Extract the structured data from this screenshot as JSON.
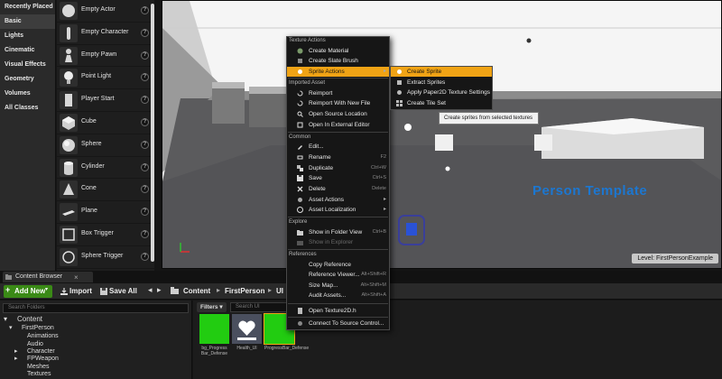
{
  "place_actors": {
    "categories": [
      "Recently Placed",
      "Basic",
      "Lights",
      "Cinematic",
      "Visual Effects",
      "Geometry",
      "Volumes",
      "All Classes"
    ],
    "selected_category": "Basic",
    "items": [
      {
        "name": "Empty Actor",
        "icon": "empty-actor-icon"
      },
      {
        "name": "Empty Character",
        "icon": "empty-character-icon"
      },
      {
        "name": "Empty Pawn",
        "icon": "empty-pawn-icon"
      },
      {
        "name": "Point Light",
        "icon": "point-light-icon"
      },
      {
        "name": "Player Start",
        "icon": "player-start-icon"
      },
      {
        "name": "Cube",
        "icon": "cube-icon"
      },
      {
        "name": "Sphere",
        "icon": "sphere-icon"
      },
      {
        "name": "Cylinder",
        "icon": "cylinder-icon"
      },
      {
        "name": "Cone",
        "icon": "cone-icon"
      },
      {
        "name": "Plane",
        "icon": "plane-icon"
      },
      {
        "name": "Box Trigger",
        "icon": "box-trigger-icon"
      },
      {
        "name": "Sphere Trigger",
        "icon": "sphere-trigger-icon"
      }
    ],
    "info_glyph": "?"
  },
  "viewport": {
    "floor_text": "Person Template",
    "level_label": "Level:  FirstPersonExample"
  },
  "context_menu": {
    "sections": {
      "texture_actions": "Texture Actions",
      "imported_asset": "Imported Asset",
      "common": "Common",
      "explore": "Explore",
      "references": "References"
    },
    "items": {
      "create_material": "Create Material",
      "create_slate_brush": "Create Slate Brush",
      "sprite_actions": "Sprite Actions",
      "reimport": "Reimport",
      "reimport_new_file": "Reimport With New File",
      "open_source_location": "Open Source Location",
      "open_external_editor": "Open In External Editor",
      "edit": "Edit...",
      "rename": "Rename",
      "duplicate": "Duplicate",
      "save": "Save",
      "delete": "Delete",
      "asset_actions": "Asset Actions",
      "asset_localization": "Asset Localization",
      "show_in_folder_view": "Show in Folder View",
      "show_in_explorer": "Show in Explorer",
      "copy_reference": "Copy Reference",
      "reference_viewer": "Reference Viewer...",
      "size_map": "Size Map...",
      "audit_assets": "Audit Assets...",
      "open_texture2d_h": "Open Texture2D.h",
      "connect_source_control": "Connect To Source Control..."
    },
    "shortcuts": {
      "rename": "F2",
      "duplicate": "Ctrl+W",
      "save": "Ctrl+S",
      "delete": "Delete",
      "show_in_folder_view": "Ctrl+B",
      "reference_viewer": "Alt+Shift+R",
      "size_map": "Alt+Shift+M",
      "audit_assets": "Alt+Shift+A"
    },
    "highlight_color": "#f0a315"
  },
  "submenu": {
    "items": {
      "create_sprite": "Create Sprite",
      "extract_sprites": "Extract Sprites",
      "apply_paper2d": "Apply Paper2D Texture Settings",
      "create_tile_set": "Create Tile Set"
    },
    "tooltip": "Create sprites from selected textures"
  },
  "content_browser": {
    "tab_label": "Content Browser",
    "add_new": "Add New",
    "import": "Import",
    "save_all": "Save All",
    "path": [
      "Content",
      "FirstPerson",
      "UI"
    ],
    "search_folders_placeholder": "Search Folders",
    "filters": "Filters",
    "search_ui_placeholder": "Search UI",
    "tree": {
      "root": "Content",
      "first_person": "FirstPerson",
      "children": [
        "Animations",
        "Audio",
        "Character",
        "FPWeapon",
        "Meshes",
        "Textures"
      ]
    },
    "assets": [
      {
        "name": "bg_Progress Bar_Defense",
        "color": "#22cc11"
      },
      {
        "name": "Health_UI",
        "color": "#4a4f5e"
      },
      {
        "name": "ProgressBar_Defense",
        "color": "#22cc11"
      }
    ],
    "accent_color": "#3a8a16"
  }
}
